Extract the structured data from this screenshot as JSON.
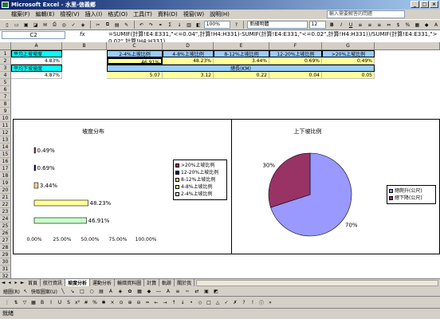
{
  "window": {
    "title": "Microsoft Excel - 水里-信義鄉"
  },
  "menu": {
    "items": [
      "檔案(F)",
      "編輯(E)",
      "檢視(V)",
      "插入(I)",
      "格式(O)",
      "工具(T)",
      "資料(D)",
      "視窗(W)",
      "說明(H)"
    ],
    "help_placeholder": "輸入需要解答的問題"
  },
  "toolbar": {
    "zoom": "100%",
    "font_name": "新細明體",
    "font_size": "12"
  },
  "formula_bar": {
    "cell_ref": "C2",
    "fx": "fx",
    "formula": "=SUMIF(計算!E4:E331,\"<=0.04\",計算!H4:H331)-SUMIF(計算!E4:E331,\"<=0.02\",計算!H4:H331))/SUMIF(計算!E4:E331,\">0.02\",計算!H4:H331)"
  },
  "columns": [
    "A",
    "B",
    "C",
    "D",
    "E",
    "F",
    "G"
  ],
  "rows": [
    "1",
    "2",
    "3",
    "4",
    "5",
    "6",
    "7",
    "8",
    "9",
    "10",
    "11",
    "12",
    "13",
    "14",
    "15",
    "16",
    "17",
    "18",
    "19",
    "20",
    "21",
    "22",
    "23",
    "24",
    "25",
    "26",
    "27",
    "28",
    "29",
    "30",
    "31",
    "32"
  ],
  "cells": {
    "a1": "平均上坡坡度",
    "a2": "4.83%",
    "a3": "平均下坡坡度",
    "a4": "4.87%",
    "c1": "2-4%上坡比例",
    "d1": "4-8%上坡比例",
    "e1": "8-12%上坡比例",
    "f1": "12-20%上坡比例",
    "g1": ">20%上坡比例",
    "c2": "46.91%",
    "d2": "48.23%",
    "e2": "3.44%",
    "f2": "0.69%",
    "g2": "0.49%",
    "d3": "總長(KM)",
    "c4": "5.07",
    "d4": "3.12",
    "e4": "0.22",
    "f4": "0.04",
    "g4": "0.05"
  },
  "chart_data": [
    {
      "type": "bar",
      "title": "坡度分布",
      "orientation": "horizontal",
      "categories": [
        "2-4%上坡比例",
        "4-8%上坡比例",
        "8-12%上坡比例",
        "12-20%上坡比例",
        ">20%上坡比例"
      ],
      "values": [
        46.91,
        48.23,
        3.44,
        0.69,
        0.49
      ],
      "value_labels": [
        "46.91%",
        "48.23%",
        "3.44%",
        "0.69%",
        "0.49%"
      ],
      "colors": [
        "#ccffcc",
        "#ffff99",
        "#ffcc99",
        "#000080",
        "#993366"
      ],
      "xlim": [
        0,
        100
      ],
      "xticks": [
        "0.00%",
        "25.00%",
        "50.00%",
        "75.00%",
        "100.00%"
      ],
      "legend_order": [
        ">20%上坡比例",
        "12-20%上坡比例",
        "8-12%上坡比例",
        "4-8%上坡比例",
        "2-4%上坡比例"
      ],
      "legend_colors": [
        "#993366",
        "#000080",
        "#ffcc99",
        "#ffff99",
        "#ccffcc"
      ],
      "legend_position": "right"
    },
    {
      "type": "pie",
      "title": "上下坡比例",
      "slices": [
        {
          "name": "總爬升(公尺)",
          "value": 70,
          "label": "70%",
          "color": "#9999ff"
        },
        {
          "name": "總下降(公尺)",
          "value": 30,
          "label": "30%",
          "color": "#993366"
        }
      ],
      "legend_position": "right"
    }
  ],
  "sheet_tabs": [
    "首頁",
    "航行資訊",
    "坡度分析",
    "運動分析",
    "輸錯資料圖",
    "計算",
    "軌跡",
    "關於我"
  ],
  "active_tab": "坡度分析",
  "drawing_toolbar": {
    "draw_label": "繪圖(R)",
    "autoshape_label": "快取圖案(U)"
  },
  "status": {
    "text": "就緒"
  }
}
